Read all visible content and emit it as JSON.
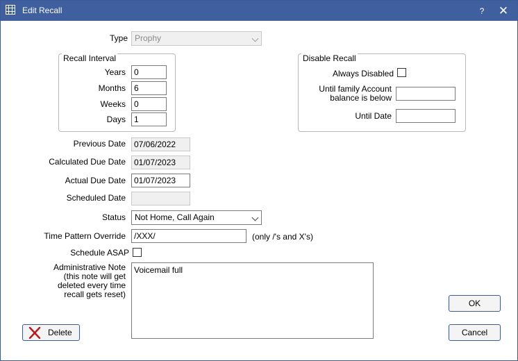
{
  "window": {
    "title": "Edit Recall",
    "help_label": "?",
    "close_label": "✕"
  },
  "type": {
    "label": "Type",
    "value": "Prophy"
  },
  "recall_interval": {
    "title": "Recall Interval",
    "years_label": "Years",
    "years_value": "0",
    "months_label": "Months",
    "months_value": "6",
    "weeks_label": "Weeks",
    "weeks_value": "0",
    "days_label": "Days",
    "days_value": "1"
  },
  "disable_recall": {
    "title": "Disable Recall",
    "always_disabled_label": "Always Disabled",
    "balance_label_line1": "Until family Account",
    "balance_label_line2": "balance is below",
    "balance_value": "",
    "until_date_label": "Until Date",
    "until_date_value": ""
  },
  "dates": {
    "previous_label": "Previous Date",
    "previous_value": "07/06/2022",
    "calculated_label": "Calculated Due Date",
    "calculated_value": "01/07/2023",
    "actual_label": "Actual Due Date",
    "actual_value": "01/07/2023",
    "scheduled_label": "Scheduled Date",
    "scheduled_value": ""
  },
  "status": {
    "label": "Status",
    "value": "Not Home, Call Again"
  },
  "time_pattern": {
    "label": "Time Pattern Override",
    "value": "/XXX/",
    "hint": "(only /'s and X's)"
  },
  "schedule_asap": {
    "label": "Schedule ASAP"
  },
  "admin_note": {
    "label_line1": "Administrative Note",
    "label_line2": "(this note will get",
    "label_line3": "deleted every time",
    "label_line4": "recall gets reset)",
    "value": "Voicemail full"
  },
  "buttons": {
    "ok": "OK",
    "cancel": "Cancel",
    "delete": "Delete"
  },
  "colors": {
    "titlebar": "#3f5f9f",
    "delete_icon": "#c0141b"
  }
}
